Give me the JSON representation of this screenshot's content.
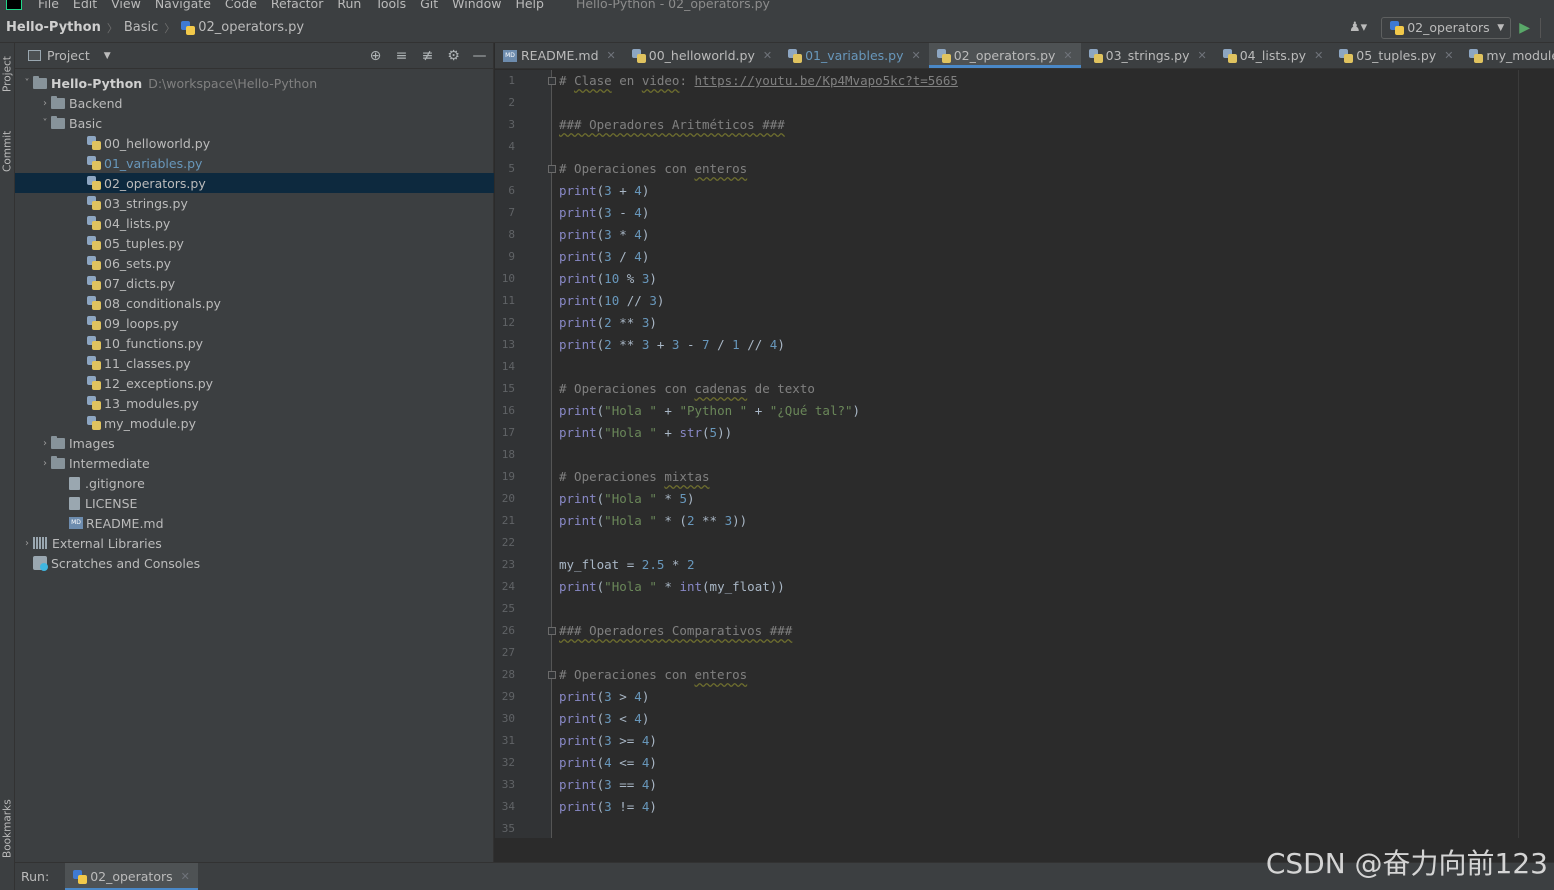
{
  "menubar": {
    "items": [
      "File",
      "Edit",
      "View",
      "Navigate",
      "Code",
      "Refactor",
      "Run",
      "Tools",
      "Git",
      "Window",
      "Help"
    ],
    "window_title": "Hello-Python - 02_operators.py"
  },
  "navbar": {
    "project": "Hello-Python",
    "folder": "Basic",
    "file": "02_operators.py",
    "run_config": "02_operators"
  },
  "left_stripe": {
    "project_label": "Project",
    "commit_label": "Commit",
    "bookmarks_label": "Bookmarks"
  },
  "project_panel": {
    "title": "Project",
    "root_name": "Hello-Python",
    "root_path": "D:\\workspace\\Hello-Python",
    "items": [
      {
        "label": "Backend",
        "kind": "folder"
      },
      {
        "label": "Basic",
        "kind": "folder"
      },
      {
        "label": "00_helloworld.py",
        "kind": "py"
      },
      {
        "label": "01_variables.py",
        "kind": "py",
        "changed": true
      },
      {
        "label": "02_operators.py",
        "kind": "py",
        "selected": true
      },
      {
        "label": "03_strings.py",
        "kind": "py"
      },
      {
        "label": "04_lists.py",
        "kind": "py"
      },
      {
        "label": "05_tuples.py",
        "kind": "py"
      },
      {
        "label": "06_sets.py",
        "kind": "py"
      },
      {
        "label": "07_dicts.py",
        "kind": "py"
      },
      {
        "label": "08_conditionals.py",
        "kind": "py"
      },
      {
        "label": "09_loops.py",
        "kind": "py"
      },
      {
        "label": "10_functions.py",
        "kind": "py"
      },
      {
        "label": "11_classes.py",
        "kind": "py"
      },
      {
        "label": "12_exceptions.py",
        "kind": "py"
      },
      {
        "label": "13_modules.py",
        "kind": "py"
      },
      {
        "label": "my_module.py",
        "kind": "py"
      },
      {
        "label": "Images",
        "kind": "folder"
      },
      {
        "label": "Intermediate",
        "kind": "folder"
      },
      {
        "label": ".gitignore",
        "kind": "file"
      },
      {
        "label": "LICENSE",
        "kind": "file"
      },
      {
        "label": "README.md",
        "kind": "md"
      },
      {
        "label": "External Libraries",
        "kind": "lib"
      },
      {
        "label": "Scratches and Consoles",
        "kind": "scratch"
      }
    ]
  },
  "tabs": [
    {
      "label": "README.md",
      "kind": "md"
    },
    {
      "label": "00_helloworld.py",
      "kind": "py"
    },
    {
      "label": "01_variables.py",
      "kind": "py",
      "changed": true
    },
    {
      "label": "02_operators.py",
      "kind": "py",
      "active": true
    },
    {
      "label": "03_strings.py",
      "kind": "py"
    },
    {
      "label": "04_lists.py",
      "kind": "py"
    },
    {
      "label": "05_tuples.py",
      "kind": "py"
    },
    {
      "label": "my_module.py",
      "kind": "py"
    }
  ],
  "code_lines": [
    "# Clase en video: https://youtu.be/Kp4Mvapo5kc?t=5665",
    "",
    "### Operadores Aritméticos ###",
    "",
    "# Operaciones con enteros",
    "print(3 + 4)",
    "print(3 - 4)",
    "print(3 * 4)",
    "print(3 / 4)",
    "print(10 % 3)",
    "print(10 // 3)",
    "print(2 ** 3)",
    "print(2 ** 3 + 3 - 7 / 1 // 4)",
    "",
    "# Operaciones con cadenas de texto",
    "print(\"Hola \" + \"Python \" + \"¿Qué tal?\")",
    "print(\"Hola \" + str(5))",
    "",
    "# Operaciones mixtas",
    "print(\"Hola \" * 5)",
    "print(\"Hola \" * (2 ** 3))",
    "",
    "my_float = 2.5 * 2",
    "print(\"Hola \" * int(my_float))",
    "",
    "### Operadores Comparativos ###",
    "",
    "# Operaciones con enteros",
    "print(3 > 4)",
    "print(3 < 4)",
    "print(3 >= 4)",
    "print(4 <= 4)",
    "print(3 == 4)",
    "print(3 != 4)",
    ""
  ],
  "runbar": {
    "label": "Run:",
    "tab": "02_operators"
  },
  "watermark": "CSDN @奋力向前123"
}
